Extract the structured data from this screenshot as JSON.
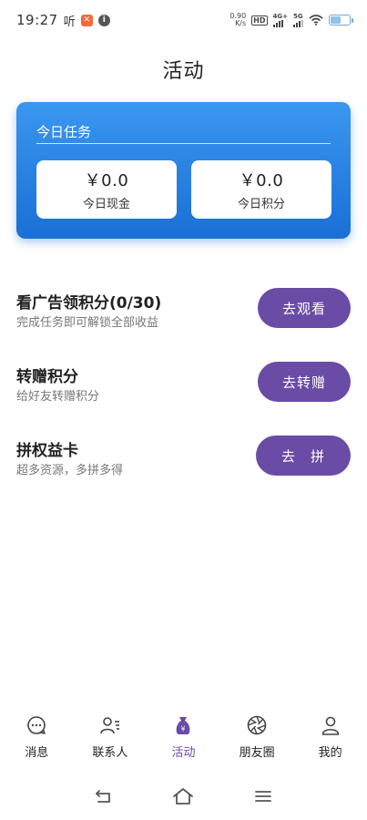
{
  "status_bar": {
    "time": "19:27",
    "app_text": "听",
    "net_speed_value": "0.90",
    "net_speed_unit": "K/s",
    "hd_label": "HD",
    "sig1_label": "4G+",
    "sig2_label": "5G"
  },
  "page": {
    "title": "活动"
  },
  "summary": {
    "title": "今日任务",
    "cash_value": "￥0.0",
    "cash_label": "今日现金",
    "points_value": "￥0.0",
    "points_label": "今日积分"
  },
  "tasks": [
    {
      "title": "看广告领积分(0/30)",
      "subtitle": "完成任务即可解锁全部收益",
      "button": "去观看"
    },
    {
      "title": "转赠积分",
      "subtitle": "给好友转赠积分",
      "button": "去转赠"
    },
    {
      "title": "拼权益卡",
      "subtitle": "超多资源，多拼多得",
      "button": "去　拼"
    }
  ],
  "nav": {
    "items": [
      {
        "label": "消息",
        "icon": "chat-bubble-icon"
      },
      {
        "label": "联系人",
        "icon": "contacts-icon"
      },
      {
        "label": "活动",
        "icon": "money-bag-icon"
      },
      {
        "label": "朋友圈",
        "icon": "aperture-icon"
      },
      {
        "label": "我的",
        "icon": "user-icon"
      }
    ],
    "active_index": 2
  },
  "colors": {
    "accent": "#6a4ba5",
    "card_blue": "#2a84e4"
  }
}
